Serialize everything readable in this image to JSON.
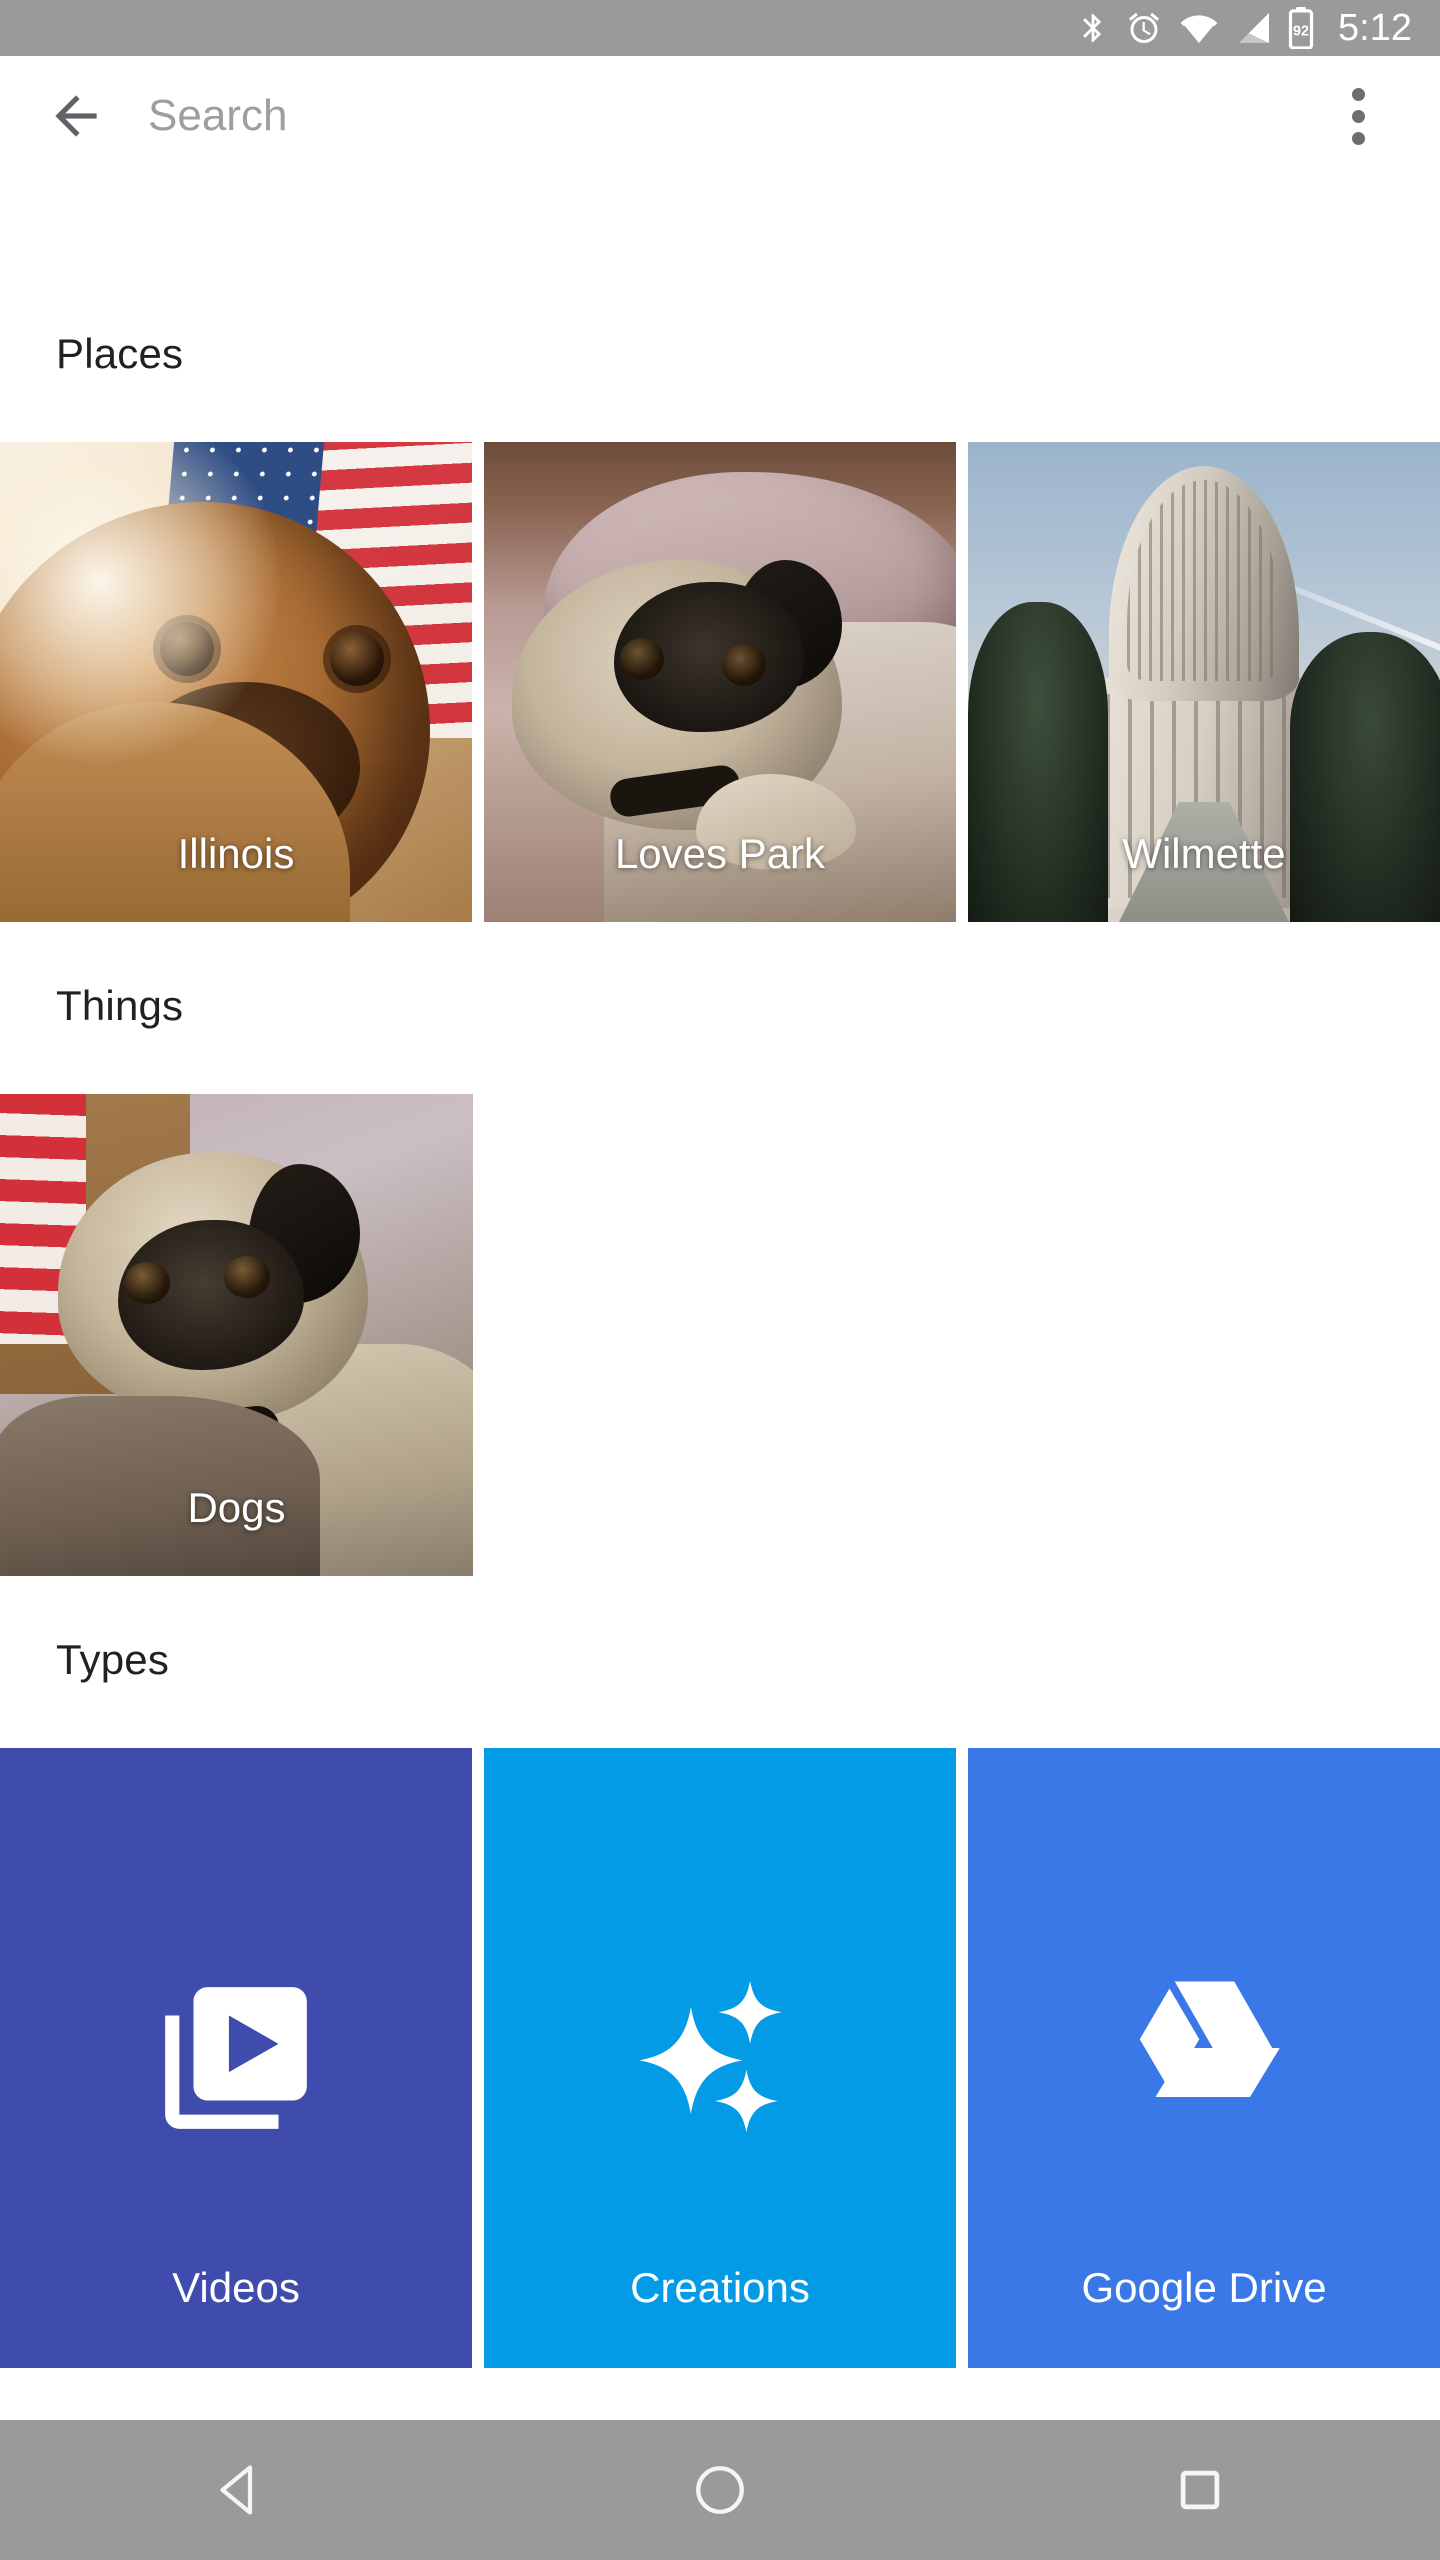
{
  "status_bar": {
    "time": "5:12",
    "battery_level": "92",
    "icons": [
      "bluetooth-icon",
      "alarm-icon",
      "wifi-icon",
      "cellular-signal-icon",
      "battery-icon"
    ],
    "background_color": "#9a9a9a"
  },
  "app_bar": {
    "back_label": "Back",
    "search_placeholder": "Search",
    "search_value": "",
    "overflow_label": "More options"
  },
  "sections": [
    {
      "id": "places",
      "title": "Places",
      "tiles": [
        {
          "label": "Illinois",
          "kind": "photo"
        },
        {
          "label": "Loves Park",
          "kind": "photo"
        },
        {
          "label": "Wilmette",
          "kind": "photo"
        }
      ]
    },
    {
      "id": "things",
      "title": "Things",
      "tiles": [
        {
          "label": "Dogs",
          "kind": "photo"
        }
      ]
    },
    {
      "id": "types",
      "title": "Types",
      "tiles": [
        {
          "label": "Videos",
          "icon": "video-library-icon",
          "color": "#3f4cad"
        },
        {
          "label": "Creations",
          "icon": "sparkle-icon",
          "color": "#039be5"
        },
        {
          "label": "Google Drive",
          "icon": "google-drive-icon",
          "color": "#3b78e7"
        }
      ]
    }
  ],
  "nav_bar": {
    "back_label": "Back",
    "home_label": "Home",
    "recents_label": "Recent apps",
    "background_color": "#9a9a9a"
  }
}
